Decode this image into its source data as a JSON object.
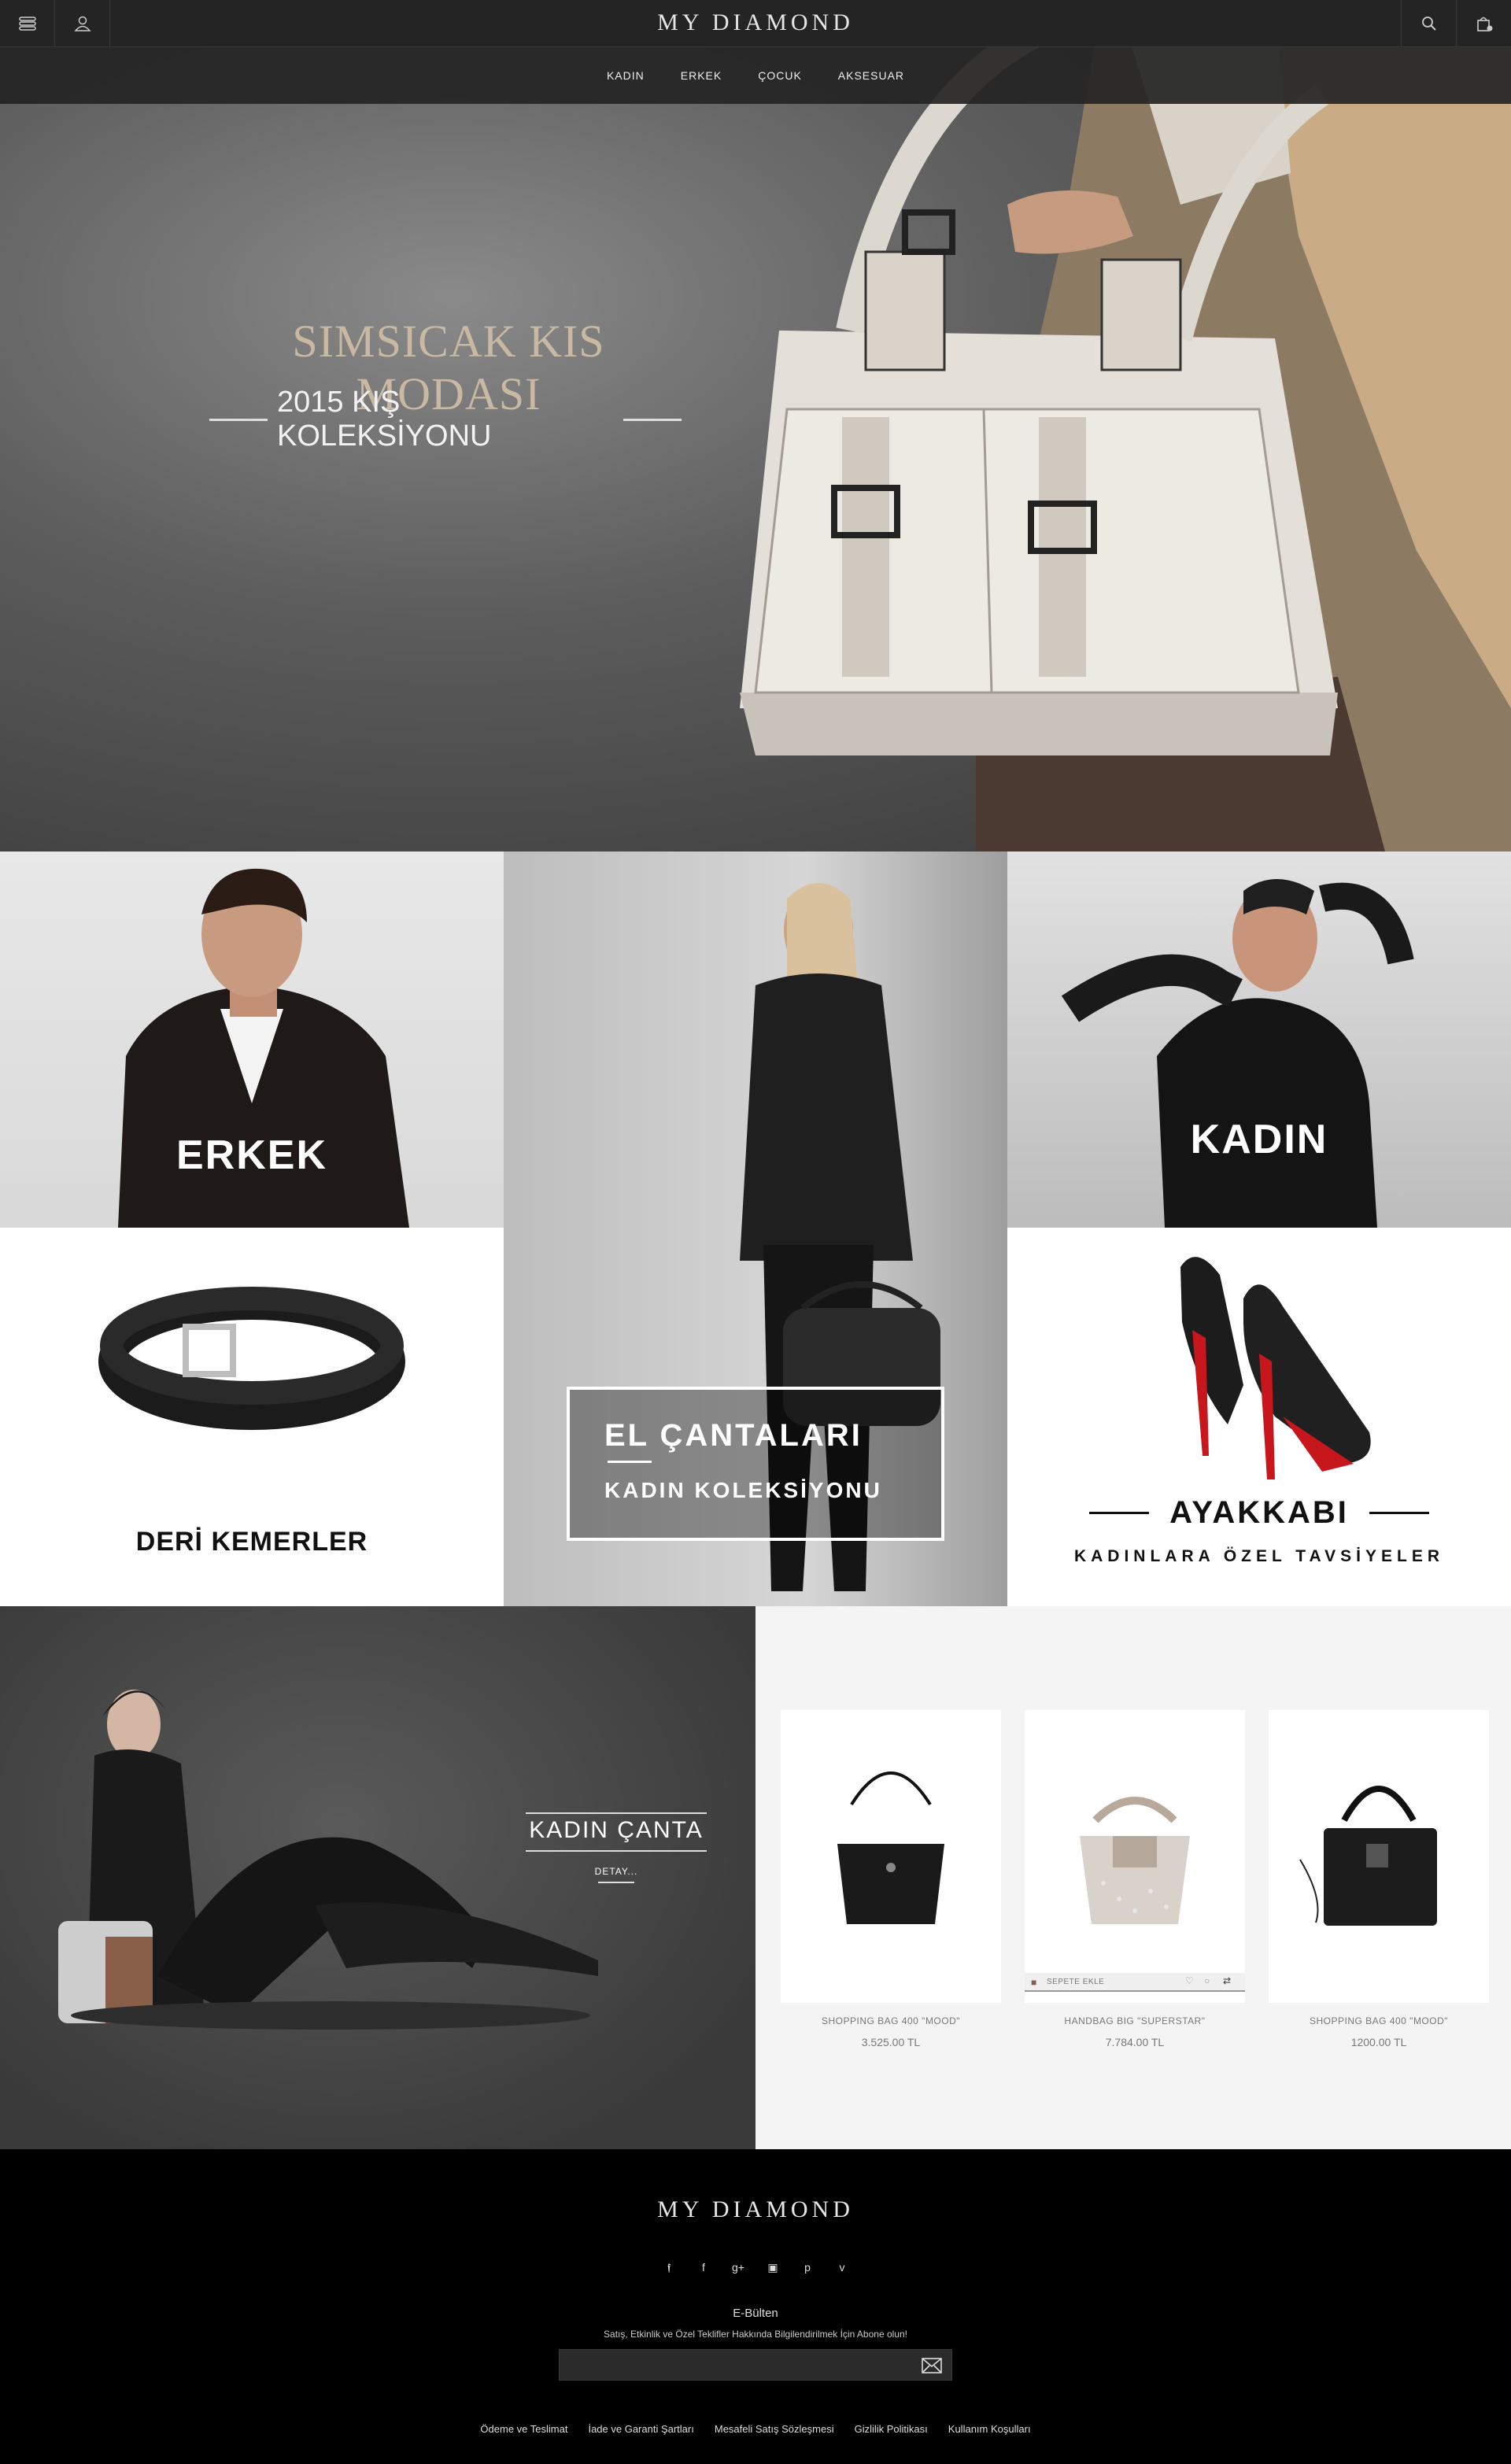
{
  "header": {
    "logo": "MY DIAMOND",
    "nav": [
      "KADIN",
      "ERKEK",
      "ÇOCUK",
      "AKSESUAR"
    ]
  },
  "hero": {
    "title": "SIMSICAK KIS MODASI",
    "subtitle": "2015 KIŞ KOLEKSİYONU"
  },
  "tiles": {
    "erkek": "ERKEK",
    "kadin": "KADIN",
    "belts": "DERİ KEMERLER",
    "bags_title": "EL ÇANTALARI",
    "bags_sub": "KADIN KOLEKSİYONU",
    "shoes_title": "AYAKKABI",
    "shoes_sub": "KADINLARA ÖZEL TAVSİYELER"
  },
  "promo": {
    "title": "KADIN ÇANTA",
    "link": "DETAY..."
  },
  "products": [
    {
      "name": "SHOPPING BAG 400 \"MOOD\"",
      "price": "3.525.00 TL"
    },
    {
      "name": "HANDBAG BIG \"SUPERSTAR\"",
      "price": "7.784.00 TL",
      "cart_label": "SEPETE EKLE"
    },
    {
      "name": "SHOPPING BAG 400 \"MOOD\"",
      "price": "1200.00 TL"
    }
  ],
  "footer": {
    "logo": "MY DIAMOND",
    "social_icons": [
      "twitter-icon",
      "facebook-icon",
      "google-plus-icon",
      "instagram-icon",
      "pinterest-icon",
      "vine-icon"
    ],
    "newsletter_title": "E-Bülten",
    "newsletter_desc": "Satış, Etkinlik ve Özel Teklifler Hakkında Bilgilendirilmek İçin Abone olun!",
    "links": [
      "Ödeme ve Teslimat",
      "İade ve Garanti Şartları",
      "Mesafeli Satış Sözleşmesi",
      "Gizlilik Politikası",
      "Kullanım Koşulları"
    ]
  },
  "colors": {
    "header_bg": "#242424",
    "hero_title": "#c9b9a2",
    "shoe_sole": "#c8161d"
  }
}
